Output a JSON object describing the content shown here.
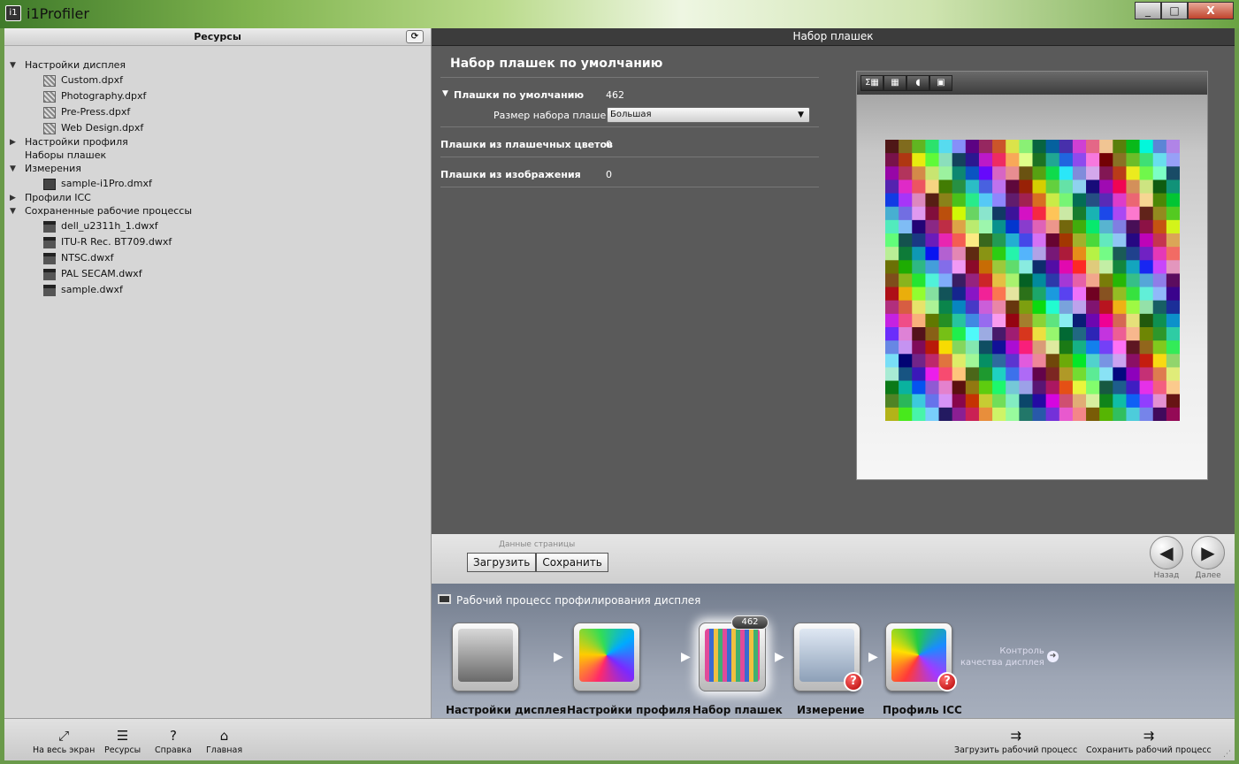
{
  "window": {
    "title": "i1Profiler",
    "minimize": "_",
    "maximize": "□",
    "close": "X"
  },
  "resources": {
    "header": "Ресурсы",
    "refresh": "⟳",
    "tree": [
      {
        "label": "Настройки дисплея",
        "level": 0,
        "expand": "▼",
        "icon": "none"
      },
      {
        "label": "Custom.dpxf",
        "level": 1,
        "icon": "doc"
      },
      {
        "label": "Photography.dpxf",
        "level": 1,
        "icon": "doc"
      },
      {
        "label": "Pre-Press.dpxf",
        "level": 1,
        "icon": "doc"
      },
      {
        "label": "Web Design.dpxf",
        "level": 1,
        "icon": "doc"
      },
      {
        "label": "Настройки профиля",
        "level": 0,
        "expand": "▶",
        "icon": "none"
      },
      {
        "label": "Наборы плашек",
        "level": 0,
        "expand": "",
        "icon": "none"
      },
      {
        "label": "Измерения",
        "level": 0,
        "expand": "▼",
        "icon": "none"
      },
      {
        "label": "sample-i1Pro.dmxf",
        "level": 1,
        "icon": "meas"
      },
      {
        "label": "Профили ICC",
        "level": 0,
        "expand": "▶",
        "icon": "none"
      },
      {
        "label": "Сохраненные рабочие процессы",
        "level": 0,
        "expand": "▼",
        "icon": "none"
      },
      {
        "label": "dell_u2311h_1.dwxf",
        "level": 1,
        "icon": "mon"
      },
      {
        "label": "ITU-R Rec. BT709.dwxf",
        "level": 1,
        "icon": "mon"
      },
      {
        "label": "NTSC.dwxf",
        "level": 1,
        "icon": "mon"
      },
      {
        "label": "PAL SECAM.dwxf",
        "level": 1,
        "icon": "mon"
      },
      {
        "label": "sample.dwxf",
        "level": 1,
        "icon": "mon"
      }
    ]
  },
  "main": {
    "header": "Набор плашек",
    "title": "Набор плашек по умолчанию",
    "default_patches_label": "Плашки по умолчанию",
    "default_patches_value": "462",
    "size_label": "Размер набора плашек:",
    "size_value": "Большая",
    "spot_label": "Плашки из плашечных цветов",
    "spot_value": "0",
    "image_label": "Плашки из изображения",
    "image_value": "0",
    "preview_tools": [
      "Σ▦",
      "▦",
      "◖",
      "▣"
    ]
  },
  "page_data": {
    "caption": "Данные страницы",
    "load": "Загрузить",
    "save": "Сохранить",
    "back": "Назад",
    "next": "Далее",
    "back_glyph": "◀",
    "next_glyph": "▶"
  },
  "workflow": {
    "title": "Рабочий процесс профилирования дисплея",
    "steps": [
      {
        "label": "Настройки дисплея"
      },
      {
        "label": "Настройки профиля"
      },
      {
        "label": "Набор плашек",
        "badge": "462"
      },
      {
        "label": "Измерение",
        "alert": "?"
      },
      {
        "label": "Профиль ICC",
        "alert": "?"
      }
    ],
    "qc_line1": "Контроль",
    "qc_line2": "качества дисплея",
    "arrow": "▶",
    "qc_glyph": "➜"
  },
  "bottombar": {
    "fullscreen": "На весь экран",
    "resources": "Ресурсы",
    "help": "Справка",
    "home": "Главная",
    "load_workflow": "Загрузить рабочий процесс",
    "save_workflow": "Сохранить рабочий процесс",
    "icons": {
      "fullscreen": "⤢",
      "resources": "☰",
      "help": "?",
      "home": "⌂",
      "load": "⇉",
      "save": "⇉"
    }
  },
  "colors": {
    "accent": "#5a5a5a",
    "panel": "#d6d6d6",
    "alert": "#cc0000"
  }
}
